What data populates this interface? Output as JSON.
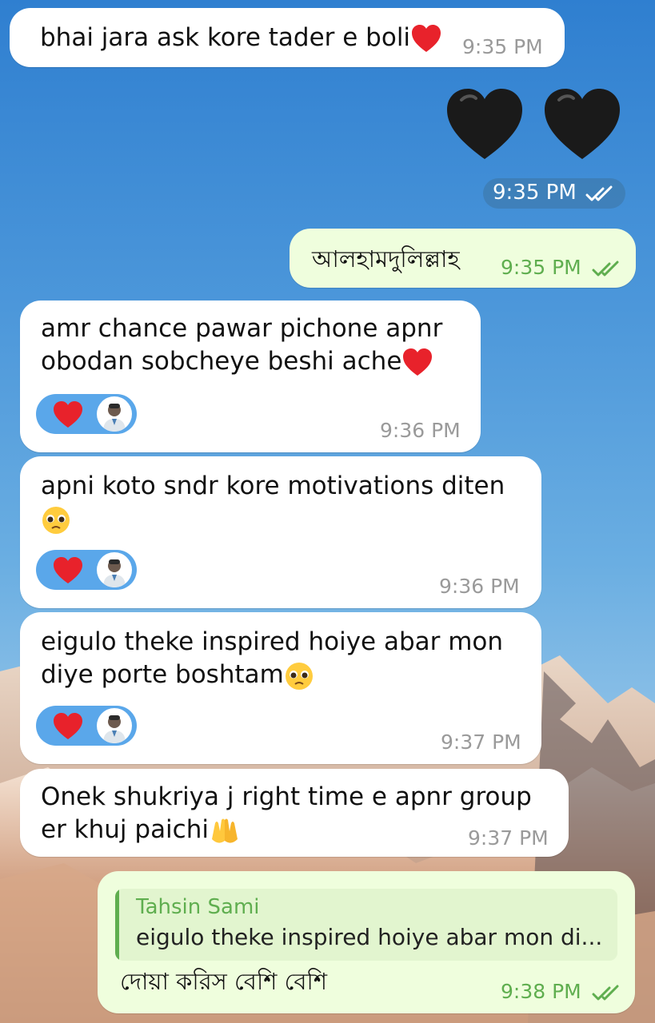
{
  "messages": [
    {
      "text": "bhai jara ask kore tader e boli",
      "time": "9:35 PM"
    },
    {
      "time": "9:35 PM",
      "sticker": "two black hearts"
    },
    {
      "text": "আলহামদুলিল্লাহ",
      "time": "9:35 PM"
    },
    {
      "line1": "amr chance pawar pichone apnr",
      "line2": "obodan sobcheye beshi ache",
      "time": "9:36 PM"
    },
    {
      "line1": "apni koto sndr kore motivations diten",
      "time": "9:36 PM"
    },
    {
      "line1": "eigulo theke inspired hoiye abar mon",
      "line2": "diye porte boshtam",
      "time": "9:37 PM"
    },
    {
      "line1": "Onek shukriya j right time e apnr group",
      "line2": "er khuj paichi",
      "time": "9:37 PM"
    },
    {
      "reply_name": "Tahsin Sami",
      "reply_text": "eigulo theke inspired hoiye abar mon di...",
      "text": "দোয়া করিস বেশি বেশি",
      "time": "9:38 PM"
    }
  ],
  "icons": {
    "heart": "red-heart-emoji",
    "black_heart": "black-heart-emoji",
    "pleading": "pleading-face-emoji",
    "hands": "raising-hands-emoji",
    "read": "double-check-icon"
  },
  "colors": {
    "outgoing_bubble": "#effedd",
    "incoming_bubble": "#ffffff",
    "reaction_pill": "#5aa7ea",
    "check": "#5fae4f"
  }
}
